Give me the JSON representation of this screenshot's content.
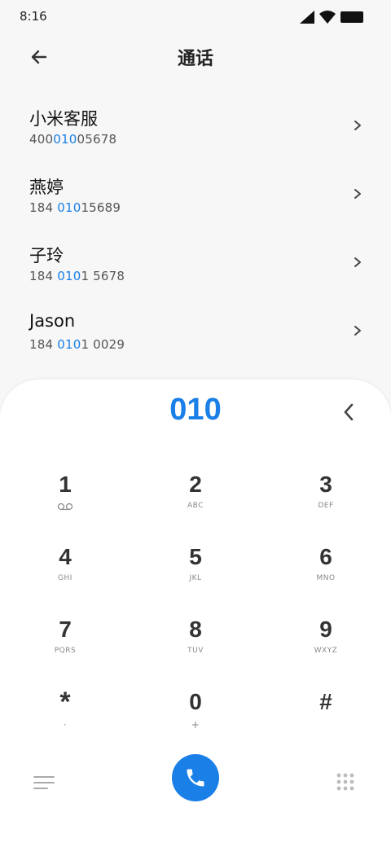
{
  "status": {
    "time": "8:16"
  },
  "header": {
    "title": "通话"
  },
  "results": [
    {
      "name": "小米客服",
      "num_pre": "400",
      "num_hl": "010",
      "num_post": "05678"
    },
    {
      "name": "燕婷",
      "num_pre": "184 ",
      "num_hl": "010",
      "num_post": "15689"
    },
    {
      "name": "子玲",
      "num_pre": "184 ",
      "num_hl": "010",
      "num_post": "1 5678"
    },
    {
      "name": "Jason",
      "num_pre": "184 ",
      "num_hl": "010",
      "num_post": "1 0029"
    }
  ],
  "dialer": {
    "input": "010"
  },
  "keys": [
    {
      "digit": "1",
      "letters": ""
    },
    {
      "digit": "2",
      "letters": "ABC"
    },
    {
      "digit": "3",
      "letters": "DEF"
    },
    {
      "digit": "4",
      "letters": "GHI"
    },
    {
      "digit": "5",
      "letters": "JKL"
    },
    {
      "digit": "6",
      "letters": "MNO"
    },
    {
      "digit": "7",
      "letters": "PQRS"
    },
    {
      "digit": "8",
      "letters": "TUV"
    },
    {
      "digit": "9",
      "letters": "WXYZ"
    },
    {
      "digit": "*",
      "letters": ","
    },
    {
      "digit": "0",
      "letters": "+"
    },
    {
      "digit": "#",
      "letters": ""
    }
  ],
  "icons": {
    "back": "arrow-left-icon",
    "chevron": "chevron-right-icon",
    "delete": "chevron-left-icon",
    "voicemail": "voicemail-icon",
    "menu": "menu-icon",
    "call": "phone-icon",
    "keypad": "keypad-grid-icon"
  },
  "colors": {
    "accent": "#1a7fe6",
    "background": "#f7f7f7",
    "panel": "#ffffff"
  }
}
